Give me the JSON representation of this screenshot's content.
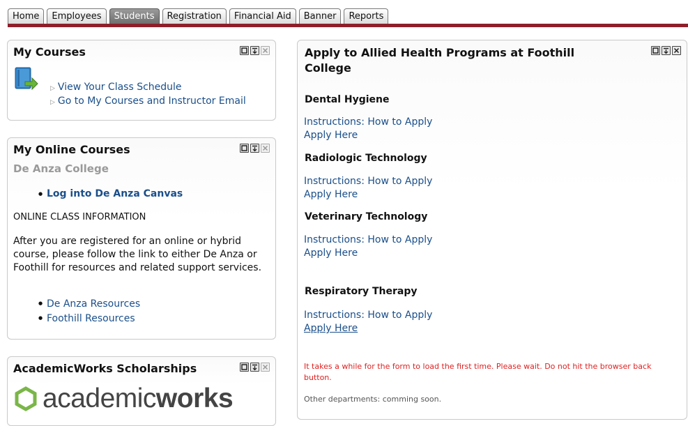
{
  "tabs": [
    "Home",
    "Employees",
    "Students",
    "Registration",
    "Financial Aid",
    "Banner",
    "Reports"
  ],
  "active_tab": "Students",
  "my_courses": {
    "title": "My Courses",
    "links": [
      "View Your Class Schedule",
      "Go to My Courses and Instructor Email"
    ]
  },
  "online_courses": {
    "title": "My Online Courses",
    "college": "De Anza College",
    "canvas_link": "Log into De Anza Canvas",
    "info_heading": "ONLINE CLASS INFORMATION",
    "info_text": "After you are registered for an online or hybrid course, please follow the link to either De Anza or Foothill for resources and related support services.",
    "resources": [
      "De Anza Resources",
      "Foothill Resources"
    ]
  },
  "scholarships": {
    "title": "AcademicWorks Scholarships",
    "logo_text_light": "academic",
    "logo_text_bold": "works"
  },
  "allied": {
    "title": "Apply to Allied Health Programs at Foothill College",
    "programs": [
      {
        "name": "Dental Hygiene",
        "instructions": "Instructions: How to Apply",
        "apply": "Apply Here"
      },
      {
        "name": "Radiologic Technology",
        "instructions": "Instructions: How to Apply",
        "apply": "Apply Here"
      },
      {
        "name": "Veterinary Technology",
        "instructions": "Instructions: How to Apply",
        "apply": "Apply Here"
      },
      {
        "name": "Respiratory Therapy",
        "instructions": "Instructions: How to Apply",
        "apply": "Apply Here"
      }
    ],
    "warning": "It takes a while for the form to load the first time. Please wait. Do not hit the browser back button.",
    "other": "Other departments: comming soon."
  },
  "colors": {
    "accent_rule": "#8e1f2a",
    "link": "#1a4f8a",
    "warning": "#e02020",
    "logo_green": "#7ab648"
  },
  "icons": {
    "panel_buttons": [
      "maximize-icon",
      "minimize-icon",
      "close-icon"
    ],
    "course_icon": "book-arrow-icon"
  }
}
